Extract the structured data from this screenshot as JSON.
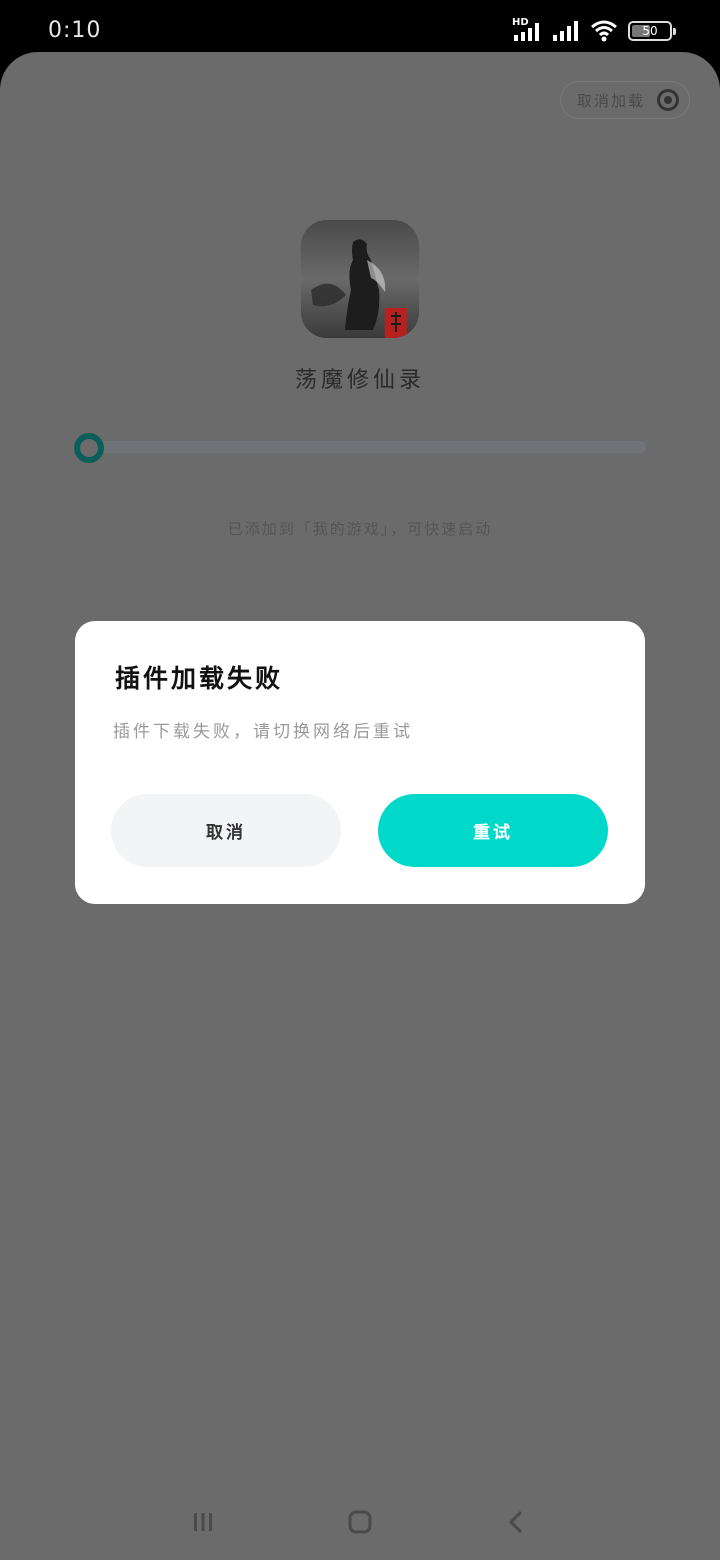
{
  "status_bar": {
    "time": "0:10",
    "network_badge": "HD",
    "battery_level": "50",
    "icons": [
      "hd-signal-icon",
      "cellular-signal-icon",
      "wifi-icon",
      "battery-icon"
    ]
  },
  "header": {
    "cancel_load_label": "取消加载"
  },
  "game": {
    "name": "荡魔修仙录",
    "icon": "game-icon"
  },
  "progress": {
    "value": 0
  },
  "hint_text": "已添加到「我的游戏」，可快速启动",
  "dialog": {
    "title": "插件加载失败",
    "message": "插件下载失败，请切换网络后重试",
    "cancel_label": "取消",
    "retry_label": "重试"
  },
  "nav_bar": {
    "icons": [
      "recent-apps-icon",
      "home-icon",
      "back-icon"
    ]
  },
  "colors": {
    "accent": "#00d9c9",
    "overlay": "#6b6b6b",
    "progress_knob": "#0a5f5a"
  }
}
